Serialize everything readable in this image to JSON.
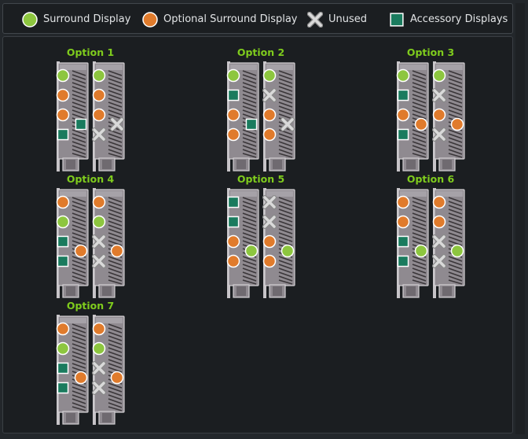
{
  "legend": [
    {
      "type": "surround",
      "label": "Surround Display"
    },
    {
      "type": "optional",
      "label": "Optional Surround Display"
    },
    {
      "type": "unused",
      "label": "Unused"
    },
    {
      "type": "accessory",
      "label": "Accessory Displays"
    }
  ],
  "colors": {
    "surround": "#8dc63f",
    "optional": "#e07b2c",
    "unused": "#d9d9d9",
    "accessory": "#1a7b5e",
    "title": "#7fcc1d"
  },
  "options": [
    {
      "title": "Option 1",
      "cards": [
        [
          "surround",
          "optional",
          "optional",
          "accessory",
          "accessory"
        ],
        [
          "surround",
          "optional",
          "optional",
          "unused",
          "unused"
        ]
      ]
    },
    {
      "title": "Option 2",
      "cards": [
        [
          "surround",
          "accessory",
          "optional",
          "optional",
          "accessory"
        ],
        [
          "surround",
          "unused",
          "optional",
          "optional",
          "unused"
        ]
      ]
    },
    {
      "title": "Option 3",
      "cards": [
        [
          "surround",
          "accessory",
          "optional",
          "accessory",
          "optional"
        ],
        [
          "surround",
          "unused",
          "optional",
          "unused",
          "optional"
        ]
      ]
    },
    {
      "title": "Option 4",
      "cards": [
        [
          "optional",
          "surround",
          "accessory",
          "accessory",
          "optional"
        ],
        [
          "optional",
          "surround",
          "unused",
          "unused",
          "optional"
        ]
      ]
    },
    {
      "title": "Option 5",
      "cards": [
        [
          "accessory",
          "accessory",
          "optional",
          "optional",
          "surround"
        ],
        [
          "unused",
          "unused",
          "optional",
          "optional",
          "surround"
        ]
      ]
    },
    {
      "title": "Option 6",
      "cards": [
        [
          "optional",
          "optional",
          "accessory",
          "accessory",
          "surround"
        ],
        [
          "optional",
          "optional",
          "unused",
          "unused",
          "surround"
        ]
      ]
    },
    {
      "title": "Option 7",
      "cards": [
        [
          "optional",
          "surround",
          "accessory",
          "accessory",
          "optional"
        ],
        [
          "optional",
          "surround",
          "unused",
          "unused",
          "optional"
        ]
      ]
    }
  ]
}
